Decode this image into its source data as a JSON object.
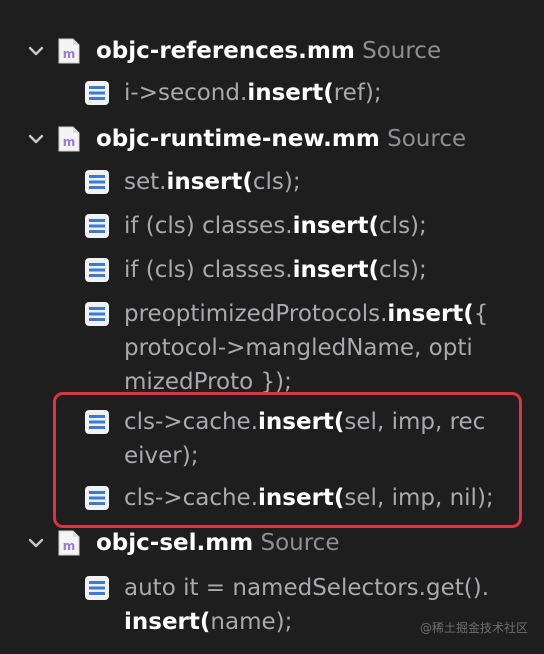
{
  "files": [
    {
      "name": "objc-references.mm",
      "type": "Source",
      "results": [
        {
          "pre": "i->second.",
          "match": "insert(",
          "post": "ref);"
        }
      ]
    },
    {
      "name": "objc-runtime-new.mm",
      "type": "Source",
      "results": [
        {
          "pre": "set.",
          "match": "insert(",
          "post": "cls);"
        },
        {
          "pre": "if (cls) classes.",
          "match": "insert(",
          "post": "cls);"
        },
        {
          "pre": "if (cls) classes.",
          "match": "insert(",
          "post": "cls);"
        },
        {
          "pre": "preoptimizedProtocols.",
          "match": "insert(",
          "post": "{\nprotocol->mangledName, opti\nmizedProto });"
        },
        {
          "pre": "cls->cache.",
          "match": "insert(",
          "post": "sel, imp, rec\neiver);"
        },
        {
          "pre": "cls->cache.",
          "match": "insert(",
          "post": "sel, imp, nil);"
        }
      ]
    },
    {
      "name": "objc-sel.mm",
      "type": "Source",
      "results": [
        {
          "pre": "auto it = namedSelectors.get().\n",
          "match": "insert(",
          "post": "name);"
        }
      ]
    }
  ],
  "watermark": "@稀土掘金技术社区",
  "colors": {
    "background": "#1e1e1e",
    "highlight_border": "#e0333f",
    "file_icon_letter": "#9b7bd8",
    "result_icon_line": "#3a7bd5"
  },
  "icons": {
    "disclosure": "chevron-down-icon",
    "file": "objc-source-file-icon",
    "result": "search-result-line-icon"
  }
}
